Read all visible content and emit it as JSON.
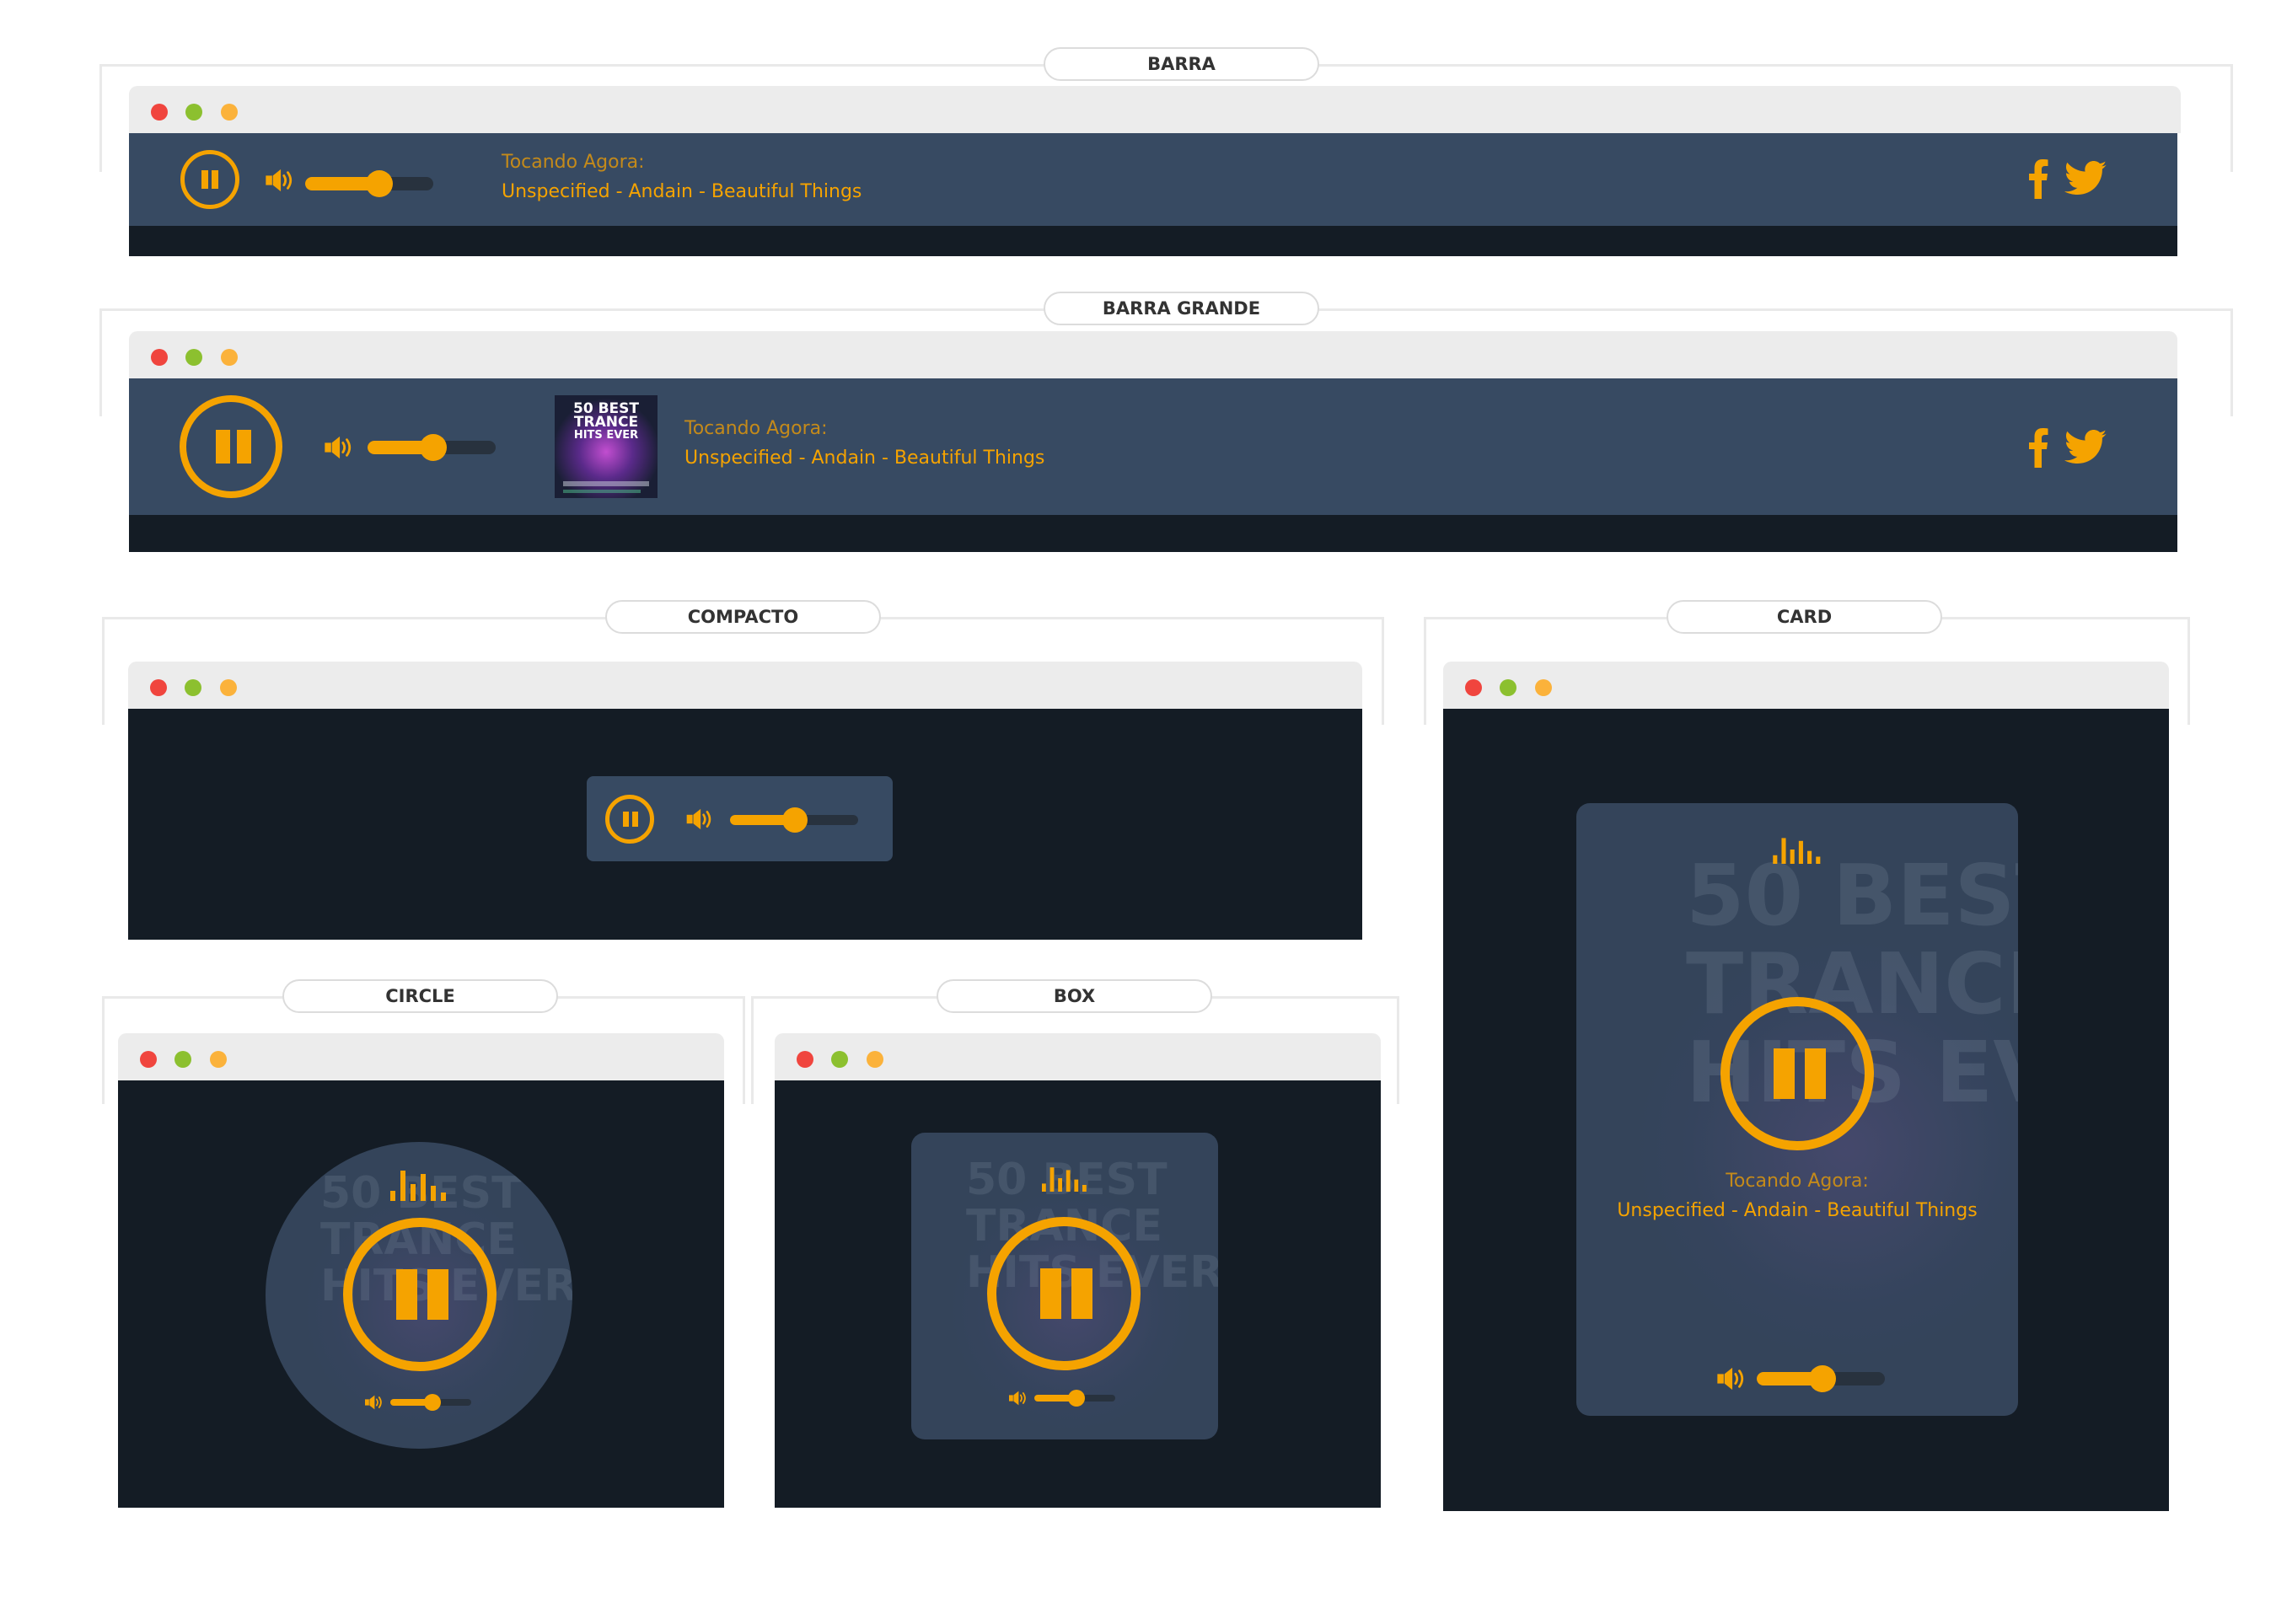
{
  "sections": {
    "barra": "BARRA",
    "barra_grande": "BARRA GRANDE",
    "compacto": "COMPACTO",
    "card": "CARD",
    "circle": "CIRCLE",
    "box": "BOX"
  },
  "now_playing": {
    "label": "Tocando Agora:",
    "track": "Unspecified - Andain - Beautiful Things"
  },
  "album_cover": {
    "lines": [
      "50 BEST",
      "TRANCE",
      "HITS EVER"
    ]
  },
  "volume": {
    "level": 0.6
  },
  "player_state": "playing",
  "icons": {
    "pause": "pause-icon",
    "volume": "volume-icon",
    "equalizer": "equalizer-icon",
    "facebook": "facebook-icon",
    "twitter": "twitter-icon"
  },
  "colors": {
    "accent": "#f5a300",
    "bar_background": "#374a62",
    "dark_background": "#141c25",
    "chrome": "#ececec",
    "dot_red": "#f0453e",
    "dot_green": "#8cc02f",
    "dot_yellow": "#fbb23b"
  }
}
